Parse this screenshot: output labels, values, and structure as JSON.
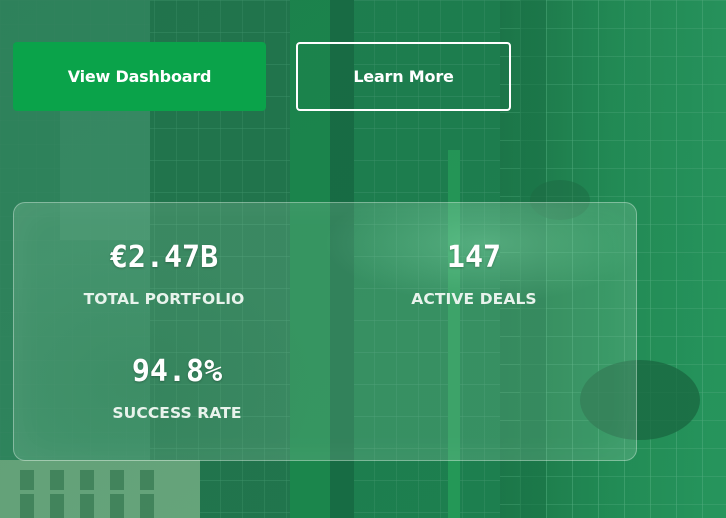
{
  "actions": {
    "primary_label": "View Dashboard",
    "secondary_label": "Learn More"
  },
  "stats": [
    {
      "value": "€2.47B",
      "label": "TOTAL PORTFOLIO"
    },
    {
      "value": "147",
      "label": "ACTIVE DEALS"
    },
    {
      "value": "94.8%",
      "label": "SUCCESS RATE"
    }
  ],
  "colors": {
    "primary_button": "#0aa34a",
    "overlay_green": "#1f6b47",
    "text": "#ffffff"
  }
}
